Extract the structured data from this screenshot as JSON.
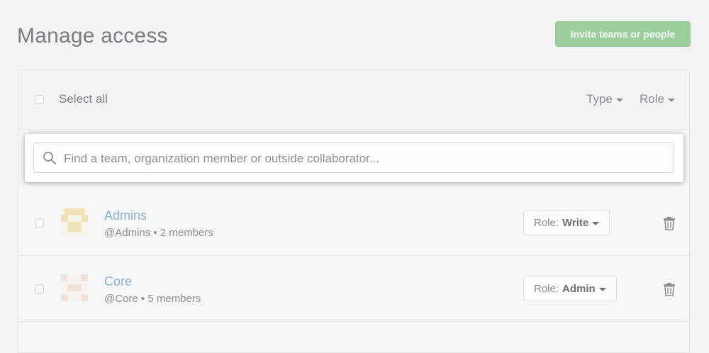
{
  "header": {
    "title": "Manage access",
    "invite_label": "Invite teams or people"
  },
  "toolbar": {
    "select_all_label": "Select all",
    "type_filter_label": "Type",
    "role_filter_label": "Role"
  },
  "search": {
    "placeholder": "Find a team, organization member or outside collaborator..."
  },
  "teams": [
    {
      "name": "Admins",
      "handle": "@Admins",
      "members": "2 members",
      "role_prefix": "Role:",
      "role_value": "Write"
    },
    {
      "name": "Core",
      "handle": "@Core",
      "members": "5 members",
      "role_prefix": "Role:",
      "role_value": "Admin"
    }
  ],
  "colors": {
    "invite_button": "#9dcf9e",
    "team_link": "#8eaedb",
    "avatar_admins": "#f1e3b8",
    "avatar_core": "#f0e2d8"
  },
  "icons": {
    "search": "search-icon",
    "delete": "trash-icon",
    "dropdown": "caret-down-icon"
  }
}
